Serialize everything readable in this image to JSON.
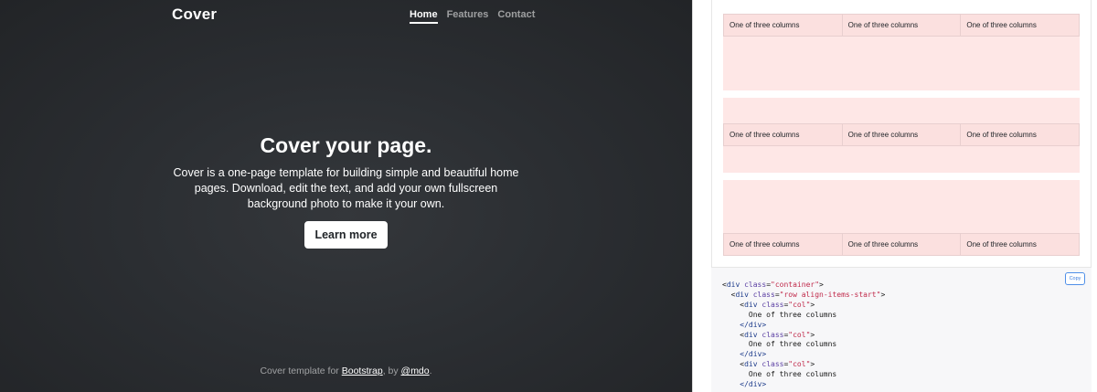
{
  "cover": {
    "brand": "Cover",
    "nav": [
      {
        "label": "Home",
        "active": true
      },
      {
        "label": "Features",
        "active": false
      },
      {
        "label": "Contact",
        "active": false
      }
    ],
    "hero": {
      "title": "Cover your page.",
      "lead": "Cover is a one-page template for building simple and beautiful home pages. Download, edit the text, and add your own fullscreen background photo to make it your own.",
      "button_label": "Learn more"
    },
    "footer": {
      "prefix": "Cover template for ",
      "link1": "Bootstrap",
      "middle": ", by ",
      "link2": "@mdo",
      "suffix": "."
    }
  },
  "docs": {
    "column_text": "One of three columns",
    "rows": [
      {
        "align": "start",
        "cells": [
          "One of three columns",
          "One of three columns",
          "One of three columns"
        ]
      },
      {
        "align": "center",
        "cells": [
          "One of three columns",
          "One of three columns",
          "One of three columns"
        ]
      },
      {
        "align": "end",
        "cells": [
          "One of three columns",
          "One of three columns",
          "One of three columns"
        ]
      }
    ],
    "copy_label": "Copy",
    "code": {
      "l1_tag": "div",
      "l1_attr": "class",
      "l1_val": "\"container\"",
      "l2_tag": "div",
      "l2_attr": "class",
      "l2_val": "\"row align-items-start\"",
      "col_tag": "div",
      "col_attr": "class",
      "col_val": "\"col\"",
      "col_text": "One of three columns",
      "close_div": "</div>"
    }
  },
  "colors": {
    "cover_bg": "#2b2e32",
    "row_bg": "#fee7e6",
    "col_bg": "#fbe0df",
    "code_bg": "#f7f7f9",
    "copy_blue": "#3b7ddd"
  }
}
